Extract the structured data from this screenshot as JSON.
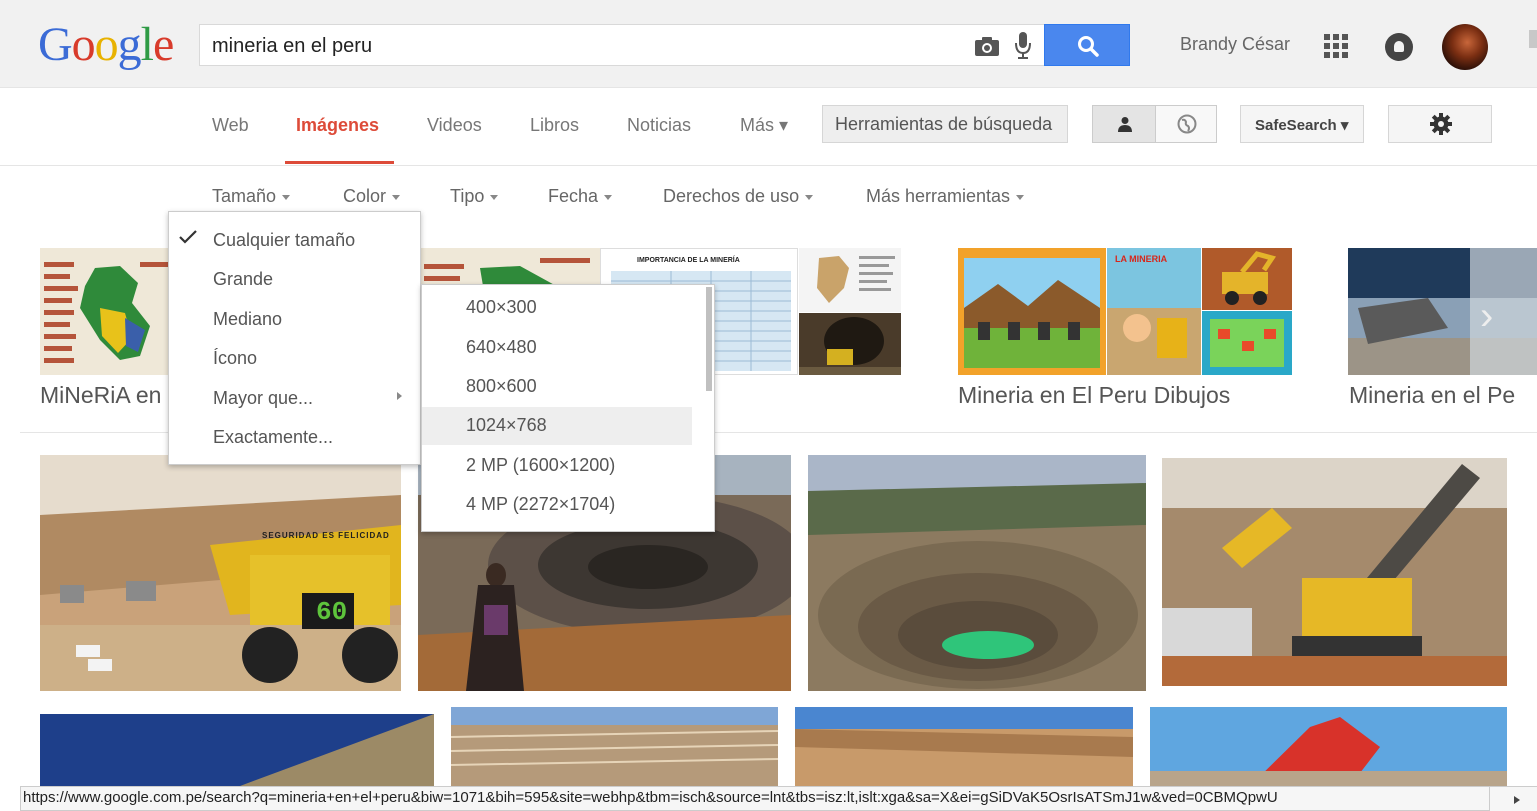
{
  "header": {
    "logo": [
      "G",
      "o",
      "o",
      "g",
      "l",
      "e"
    ],
    "search_query": "mineria en el peru",
    "user_name": "Brandy César"
  },
  "nav": {
    "tabs": [
      {
        "label": "Web",
        "active": false
      },
      {
        "label": "Imágenes",
        "active": true
      },
      {
        "label": "Videos",
        "active": false
      },
      {
        "label": "Libros",
        "active": false
      },
      {
        "label": "Noticias",
        "active": false
      },
      {
        "label": "Más ▾",
        "active": false
      }
    ],
    "tools_button": "Herramientas de búsqueda",
    "safesearch_label": "SafeSearch ▾"
  },
  "tools": {
    "items": [
      "Tamaño",
      "Color",
      "Tipo",
      "Fecha",
      "Derechos de uso",
      "Más herramientas"
    ]
  },
  "size_menu": {
    "items": [
      "Cualquier tamaño",
      "Grande",
      "Mediano",
      "Ícono",
      "Mayor que...",
      "Exactamente..."
    ],
    "selected": "Cualquier tamaño"
  },
  "larger_than_menu": {
    "items": [
      "400×300",
      "640×480",
      "800×600",
      "1024×768",
      "2 MP (1600×1200)",
      "4 MP (2272×1704)"
    ],
    "highlighted": "1024×768"
  },
  "related": {
    "captions": [
      "MiNeRiA en",
      "Mineria en El Peru Dibujos",
      "Mineria en el Pe"
    ],
    "table_thumb_title": "IMPORTANCIA DE LA MINERÍA"
  },
  "thumb_text": {
    "truck_number": "60",
    "truck_banner": "SEGURIDAD ES FELICIDAD",
    "game_title": "LA MINERIA"
  },
  "status_url": "https://www.google.com.pe/search?q=mineria+en+el+peru&biw=1071&bih=595&site=webhp&tbm=isch&source=lnt&tbs=isz:lt,islt:xga&sa=X&ei=gSiDVaK5OsrIsATSmJ1w&ved=0CBMQpwU",
  "colors": {
    "accent_red": "#dd4b39",
    "search_blue": "#4a87ee"
  }
}
